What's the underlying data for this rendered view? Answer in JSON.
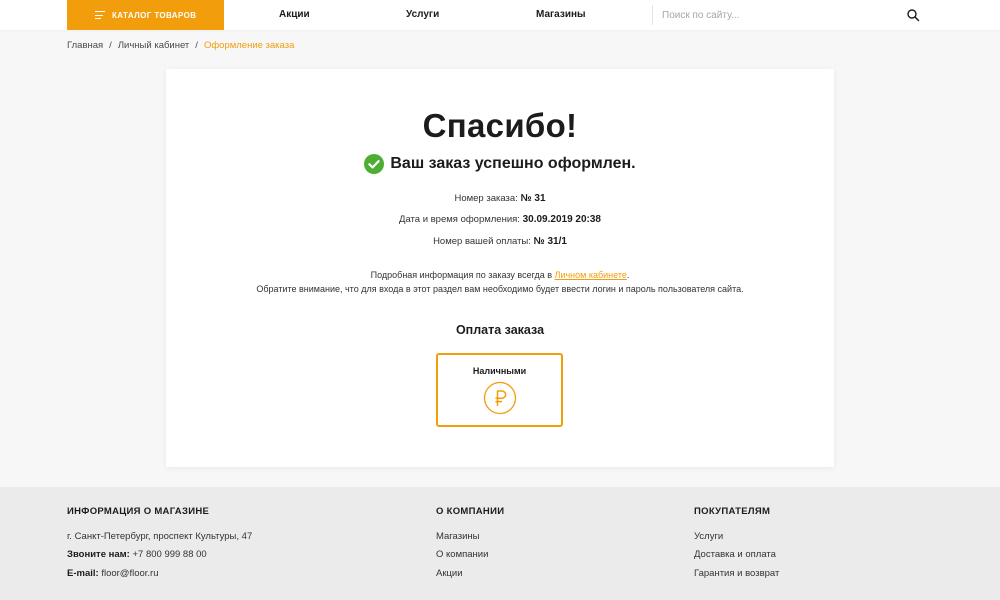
{
  "header": {
    "catalog_label": "КАТАЛОГ ТОВАРОВ",
    "nav": [
      "Акции",
      "Услуги",
      "Магазины"
    ],
    "search_placeholder": "Поиск по сайту...",
    "accent_color": "#f29d0c"
  },
  "breadcrumb": {
    "items": [
      "Главная",
      "Личный кабинет"
    ],
    "current": "Оформление заказа",
    "separator": "/"
  },
  "order": {
    "thanks": "Спасибо!",
    "success": "Ваш заказ успешно оформлен.",
    "number_label": "Номер заказа:",
    "number_value": "№ 31",
    "date_label": "Дата и время оформления:",
    "date_value": "30.09.2019 20:38",
    "payment_label": "Номер вашей оплаты:",
    "payment_value": "№ 31/1",
    "note_prefix": "Подробная информация по заказу всегда в",
    "note_link": "Личном кабинете",
    "note_suffix": ".",
    "note_line2": "Обратите внимание, что для входа в этот раздел вам необходимо будет ввести логин и пароль пользователя сайта.",
    "pay_title": "Оплата заказа",
    "pay_method": "Наличными",
    "pay_icon": "ruble-icon",
    "success_color": "#4caf33"
  },
  "footer": {
    "info_title": "ИНФОРМАЦИЯ О МАГАЗИНЕ",
    "address": "г. Санкт-Петербург, проспект Культуры, 47",
    "phone_label": "Звоните нам:",
    "phone_value": "+7 800 999 88 00",
    "email_label": "E-mail:",
    "email_value": "floor@floor.ru",
    "company_title": "О КОМПАНИИ",
    "company_links": [
      "Магазины",
      "О компании",
      "Акции"
    ],
    "buyers_title": "ПОКУПАТЕЛЯМ",
    "buyers_links": [
      "Услуги",
      "Доставка и оплата",
      "Гарантия и возврат"
    ]
  }
}
